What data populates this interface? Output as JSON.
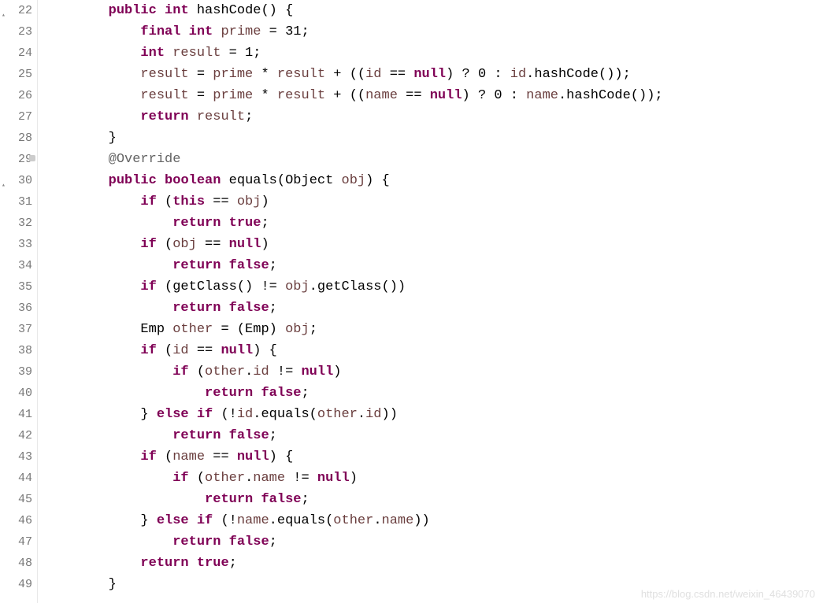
{
  "lines": [
    {
      "num": "22",
      "marked": true,
      "tokens": [
        [
          "plain",
          "        "
        ],
        [
          "kw",
          "public"
        ],
        [
          "plain",
          " "
        ],
        [
          "kw",
          "int"
        ],
        [
          "plain",
          " "
        ],
        [
          "method",
          "hashCode"
        ],
        [
          "plain",
          "() {"
        ]
      ]
    },
    {
      "num": "23",
      "tokens": [
        [
          "plain",
          "            "
        ],
        [
          "kw",
          "final"
        ],
        [
          "plain",
          " "
        ],
        [
          "kw",
          "int"
        ],
        [
          "plain",
          " "
        ],
        [
          "var",
          "prime"
        ],
        [
          "plain",
          " = 31;"
        ]
      ]
    },
    {
      "num": "24",
      "tokens": [
        [
          "plain",
          "            "
        ],
        [
          "kw",
          "int"
        ],
        [
          "plain",
          " "
        ],
        [
          "var",
          "result"
        ],
        [
          "plain",
          " = 1;"
        ]
      ]
    },
    {
      "num": "25",
      "tokens": [
        [
          "plain",
          "            "
        ],
        [
          "var",
          "result"
        ],
        [
          "plain",
          " = "
        ],
        [
          "var",
          "prime"
        ],
        [
          "plain",
          " * "
        ],
        [
          "var",
          "result"
        ],
        [
          "plain",
          " + (("
        ],
        [
          "var",
          "id"
        ],
        [
          "plain",
          " == "
        ],
        [
          "kw",
          "null"
        ],
        [
          "plain",
          ") ? 0 : "
        ],
        [
          "var",
          "id"
        ],
        [
          "plain",
          ".hashCode());"
        ]
      ]
    },
    {
      "num": "26",
      "tokens": [
        [
          "plain",
          "            "
        ],
        [
          "var",
          "result"
        ],
        [
          "plain",
          " = "
        ],
        [
          "var",
          "prime"
        ],
        [
          "plain",
          " * "
        ],
        [
          "var",
          "result"
        ],
        [
          "plain",
          " + (("
        ],
        [
          "var",
          "name"
        ],
        [
          "plain",
          " == "
        ],
        [
          "kw",
          "null"
        ],
        [
          "plain",
          ") ? 0 : "
        ],
        [
          "var",
          "name"
        ],
        [
          "plain",
          ".hashCode());"
        ]
      ]
    },
    {
      "num": "27",
      "tokens": [
        [
          "plain",
          "            "
        ],
        [
          "kw",
          "return"
        ],
        [
          "plain",
          " "
        ],
        [
          "var",
          "result"
        ],
        [
          "plain",
          ";"
        ]
      ]
    },
    {
      "num": "28",
      "tokens": [
        [
          "plain",
          "        }"
        ]
      ]
    },
    {
      "num": "29",
      "override": true,
      "tokens": [
        [
          "plain",
          "        "
        ],
        [
          "annotation",
          "@Override"
        ]
      ]
    },
    {
      "num": "30",
      "marked": true,
      "tokens": [
        [
          "plain",
          "        "
        ],
        [
          "kw",
          "public"
        ],
        [
          "plain",
          " "
        ],
        [
          "kw",
          "boolean"
        ],
        [
          "plain",
          " "
        ],
        [
          "method",
          "equals"
        ],
        [
          "plain",
          "(Object "
        ],
        [
          "var",
          "obj"
        ],
        [
          "plain",
          ") {"
        ]
      ]
    },
    {
      "num": "31",
      "tokens": [
        [
          "plain",
          "            "
        ],
        [
          "kw",
          "if"
        ],
        [
          "plain",
          " ("
        ],
        [
          "kw",
          "this"
        ],
        [
          "plain",
          " == "
        ],
        [
          "var",
          "obj"
        ],
        [
          "plain",
          ")"
        ]
      ]
    },
    {
      "num": "32",
      "tokens": [
        [
          "plain",
          "                "
        ],
        [
          "kw",
          "return"
        ],
        [
          "plain",
          " "
        ],
        [
          "kw",
          "true"
        ],
        [
          "plain",
          ";"
        ]
      ]
    },
    {
      "num": "33",
      "tokens": [
        [
          "plain",
          "            "
        ],
        [
          "kw",
          "if"
        ],
        [
          "plain",
          " ("
        ],
        [
          "var",
          "obj"
        ],
        [
          "plain",
          " == "
        ],
        [
          "kw",
          "null"
        ],
        [
          "plain",
          ")"
        ]
      ]
    },
    {
      "num": "34",
      "tokens": [
        [
          "plain",
          "                "
        ],
        [
          "kw",
          "return"
        ],
        [
          "plain",
          " "
        ],
        [
          "kw",
          "false"
        ],
        [
          "plain",
          ";"
        ]
      ]
    },
    {
      "num": "35",
      "tokens": [
        [
          "plain",
          "            "
        ],
        [
          "kw",
          "if"
        ],
        [
          "plain",
          " (getClass() != "
        ],
        [
          "var",
          "obj"
        ],
        [
          "plain",
          ".getClass())"
        ]
      ]
    },
    {
      "num": "36",
      "tokens": [
        [
          "plain",
          "                "
        ],
        [
          "kw",
          "return"
        ],
        [
          "plain",
          " "
        ],
        [
          "kw",
          "false"
        ],
        [
          "plain",
          ";"
        ]
      ]
    },
    {
      "num": "37",
      "tokens": [
        [
          "plain",
          "            Emp "
        ],
        [
          "var",
          "other"
        ],
        [
          "plain",
          " = (Emp) "
        ],
        [
          "var",
          "obj"
        ],
        [
          "plain",
          ";"
        ]
      ]
    },
    {
      "num": "38",
      "tokens": [
        [
          "plain",
          "            "
        ],
        [
          "kw",
          "if"
        ],
        [
          "plain",
          " ("
        ],
        [
          "var",
          "id"
        ],
        [
          "plain",
          " == "
        ],
        [
          "kw",
          "null"
        ],
        [
          "plain",
          ") {"
        ]
      ]
    },
    {
      "num": "39",
      "tokens": [
        [
          "plain",
          "                "
        ],
        [
          "kw",
          "if"
        ],
        [
          "plain",
          " ("
        ],
        [
          "var",
          "other"
        ],
        [
          "plain",
          "."
        ],
        [
          "var",
          "id"
        ],
        [
          "plain",
          " != "
        ],
        [
          "kw",
          "null"
        ],
        [
          "plain",
          ")"
        ]
      ]
    },
    {
      "num": "40",
      "tokens": [
        [
          "plain",
          "                    "
        ],
        [
          "kw",
          "return"
        ],
        [
          "plain",
          " "
        ],
        [
          "kw",
          "false"
        ],
        [
          "plain",
          ";"
        ]
      ]
    },
    {
      "num": "41",
      "tokens": [
        [
          "plain",
          "            } "
        ],
        [
          "kw",
          "else"
        ],
        [
          "plain",
          " "
        ],
        [
          "kw",
          "if"
        ],
        [
          "plain",
          " (!"
        ],
        [
          "var",
          "id"
        ],
        [
          "plain",
          ".equals("
        ],
        [
          "var",
          "other"
        ],
        [
          "plain",
          "."
        ],
        [
          "var",
          "id"
        ],
        [
          "plain",
          "))"
        ]
      ]
    },
    {
      "num": "42",
      "tokens": [
        [
          "plain",
          "                "
        ],
        [
          "kw",
          "return"
        ],
        [
          "plain",
          " "
        ],
        [
          "kw",
          "false"
        ],
        [
          "plain",
          ";"
        ]
      ]
    },
    {
      "num": "43",
      "tokens": [
        [
          "plain",
          "            "
        ],
        [
          "kw",
          "if"
        ],
        [
          "plain",
          " ("
        ],
        [
          "var",
          "name"
        ],
        [
          "plain",
          " == "
        ],
        [
          "kw",
          "null"
        ],
        [
          "plain",
          ") {"
        ]
      ]
    },
    {
      "num": "44",
      "tokens": [
        [
          "plain",
          "                "
        ],
        [
          "kw",
          "if"
        ],
        [
          "plain",
          " ("
        ],
        [
          "var",
          "other"
        ],
        [
          "plain",
          "."
        ],
        [
          "var",
          "name"
        ],
        [
          "plain",
          " != "
        ],
        [
          "kw",
          "null"
        ],
        [
          "plain",
          ")"
        ]
      ]
    },
    {
      "num": "45",
      "tokens": [
        [
          "plain",
          "                    "
        ],
        [
          "kw",
          "return"
        ],
        [
          "plain",
          " "
        ],
        [
          "kw",
          "false"
        ],
        [
          "plain",
          ";"
        ]
      ]
    },
    {
      "num": "46",
      "tokens": [
        [
          "plain",
          "            } "
        ],
        [
          "kw",
          "else"
        ],
        [
          "plain",
          " "
        ],
        [
          "kw",
          "if"
        ],
        [
          "plain",
          " (!"
        ],
        [
          "var",
          "name"
        ],
        [
          "plain",
          ".equals("
        ],
        [
          "var",
          "other"
        ],
        [
          "plain",
          "."
        ],
        [
          "var",
          "name"
        ],
        [
          "plain",
          "))"
        ]
      ]
    },
    {
      "num": "47",
      "tokens": [
        [
          "plain",
          "                "
        ],
        [
          "kw",
          "return"
        ],
        [
          "plain",
          " "
        ],
        [
          "kw",
          "false"
        ],
        [
          "plain",
          ";"
        ]
      ]
    },
    {
      "num": "48",
      "tokens": [
        [
          "plain",
          "            "
        ],
        [
          "kw",
          "return"
        ],
        [
          "plain",
          " "
        ],
        [
          "kw",
          "true"
        ],
        [
          "plain",
          ";"
        ]
      ]
    },
    {
      "num": "49",
      "tokens": [
        [
          "plain",
          "        }"
        ]
      ]
    }
  ],
  "watermark": "https://blog.csdn.net/weixin_46439070"
}
